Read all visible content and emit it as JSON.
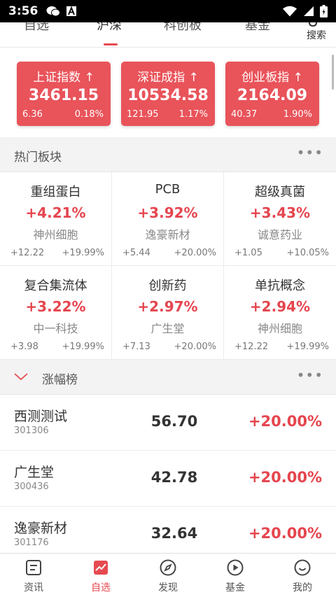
{
  "status_bar": {
    "time": "3:56"
  },
  "top_tabs": [
    {
      "label": "自选"
    },
    {
      "label": "沪深"
    },
    {
      "label": "科创板"
    },
    {
      "label": "基金"
    }
  ],
  "search": {
    "label": "搜索"
  },
  "indices": [
    {
      "name": "上证指数 ↑",
      "value": "3461.15",
      "change": "6.36",
      "pct": "0.18%"
    },
    {
      "name": "深证成指 ↑",
      "value": "10534.58",
      "change": "121.95",
      "pct": "1.17%"
    },
    {
      "name": "创业板指 ↑",
      "value": "2164.09",
      "change": "40.37",
      "pct": "1.90%"
    }
  ],
  "hot_sectors": {
    "title": "热门板块",
    "items": [
      {
        "name": "重组蛋白",
        "pct": "+4.21%",
        "leader": "神州细胞",
        "change": "+12.22",
        "leader_pct": "+19.99%"
      },
      {
        "name": "PCB",
        "pct": "+3.92%",
        "leader": "逸豪新材",
        "change": "+5.44",
        "leader_pct": "+20.00%"
      },
      {
        "name": "超级真菌",
        "pct": "+3.43%",
        "leader": "诚意药业",
        "change": "+1.05",
        "leader_pct": "+10.05%"
      },
      {
        "name": "复合集流体",
        "pct": "+3.22%",
        "leader": "中一科技",
        "change": "+3.98",
        "leader_pct": "+19.99%"
      },
      {
        "name": "创新药",
        "pct": "+2.97%",
        "leader": "广生堂",
        "change": "+7.13",
        "leader_pct": "+20.00%"
      },
      {
        "name": "单抗概念",
        "pct": "+2.94%",
        "leader": "神州细胞",
        "change": "+12.22",
        "leader_pct": "+19.99%"
      }
    ]
  },
  "rank": {
    "title": "涨幅榜",
    "rows": [
      {
        "name": "西测测试",
        "code": "301306",
        "price": "56.70",
        "pct": "+20.00%"
      },
      {
        "name": "广生堂",
        "code": "300436",
        "price": "42.78",
        "pct": "+20.00%"
      },
      {
        "name": "逸豪新材",
        "code": "301176",
        "price": "32.64",
        "pct": "+20.00%"
      }
    ]
  },
  "bottom_nav": [
    {
      "label": "资讯",
      "icon": "news-icon"
    },
    {
      "label": "自选",
      "icon": "watchlist-icon",
      "active": true
    },
    {
      "label": "发现",
      "icon": "compass-icon"
    },
    {
      "label": "基金",
      "icon": "fund-play-icon"
    },
    {
      "label": "我的",
      "icon": "smiley-icon"
    }
  ],
  "colors": {
    "accent": "#e64a50",
    "up": "#e5454f",
    "card": "#e9535a"
  }
}
